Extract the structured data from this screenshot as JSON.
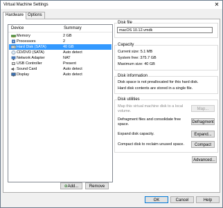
{
  "window": {
    "title": "Virtual Machine Settings"
  },
  "tabs": [
    {
      "label": "Hardware"
    },
    {
      "label": "Options"
    }
  ],
  "devices": {
    "header_device": "Device",
    "header_summary": "Summary",
    "items": [
      {
        "name": "Memory",
        "summary": "2 GB",
        "icon": "memory-icon"
      },
      {
        "name": "Processors",
        "summary": "2",
        "icon": "processor-icon"
      },
      {
        "name": "Hard Disk (SATA)",
        "summary": "40 GB",
        "icon": "hard-disk-icon"
      },
      {
        "name": "CD/DVD (SATA)",
        "summary": "Auto detect",
        "icon": "cd-dvd-icon"
      },
      {
        "name": "Network Adapter",
        "summary": "NAT",
        "icon": "network-adapter-icon"
      },
      {
        "name": "USB Controller",
        "summary": "Present",
        "icon": "usb-controller-icon"
      },
      {
        "name": "Sound Card",
        "summary": "Auto detect",
        "icon": "sound-card-icon"
      },
      {
        "name": "Display",
        "summary": "Auto detect",
        "icon": "display-icon"
      }
    ],
    "selected_index": 2
  },
  "buttons": {
    "add": "Add...",
    "remove": "Remove",
    "advanced": "Advanced...",
    "ok": "OK",
    "cancel": "Cancel",
    "help": "Help"
  },
  "disk_file": {
    "caption": "Disk file",
    "value": "macOS 10.12.vmdk"
  },
  "capacity": {
    "caption": "Capacity",
    "current_size": "Current size: 5.1 MB",
    "system_free": "System free: 375.7 GB",
    "maximum_size": "Maximum size: 40 GB"
  },
  "disk_information": {
    "caption": "Disk information",
    "line1": "Disk space is not preallocated for this hard disk.",
    "line2": "Hard disk contents are stored in a single file."
  },
  "disk_utilities": {
    "caption": "Disk utilities",
    "map_text_1": "Map this virtual machine disk to a local",
    "map_text_2": "volume.",
    "map_button": "Map...",
    "defrag_text_1": "Defragment files and consolidate free",
    "defrag_text_2": "space.",
    "defrag_button": "Defragment",
    "expand_text": "Expand disk capacity.",
    "expand_button": "Expand...",
    "compact_text": "Compact disk to reclaim unused space.",
    "compact_button": "Compact"
  },
  "colors": {
    "selection": "#3399ff",
    "accent": "#0078d7"
  }
}
